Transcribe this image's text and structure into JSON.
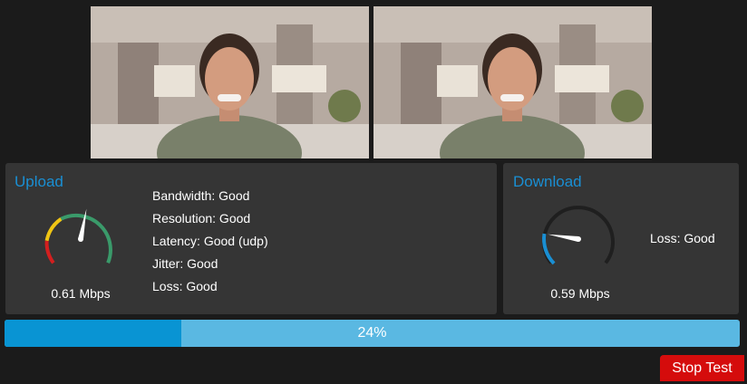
{
  "upload": {
    "title": "Upload",
    "speed": "0.61 Mbps",
    "gauge_fraction": 0.54,
    "stats": [
      "Bandwidth: Good",
      "Resolution: Good",
      "Latency: Good (udp)",
      "Jitter: Good",
      "Loss: Good"
    ]
  },
  "download": {
    "title": "Download",
    "speed": "0.59 Mbps",
    "gauge_fraction": 0.2,
    "loss": "Loss: Good"
  },
  "progress": {
    "percent": 24,
    "label": "24%"
  },
  "actions": {
    "stop_label": "Stop Test"
  },
  "colors": {
    "accent": "#1a8fd3",
    "gauge_red": "#d31f1f",
    "gauge_yellow": "#f0c514",
    "gauge_green": "#3a9a6a",
    "progress_fill": "#0994d3",
    "progress_track": "#5ab8e2",
    "stop_button": "#d50c0c"
  }
}
